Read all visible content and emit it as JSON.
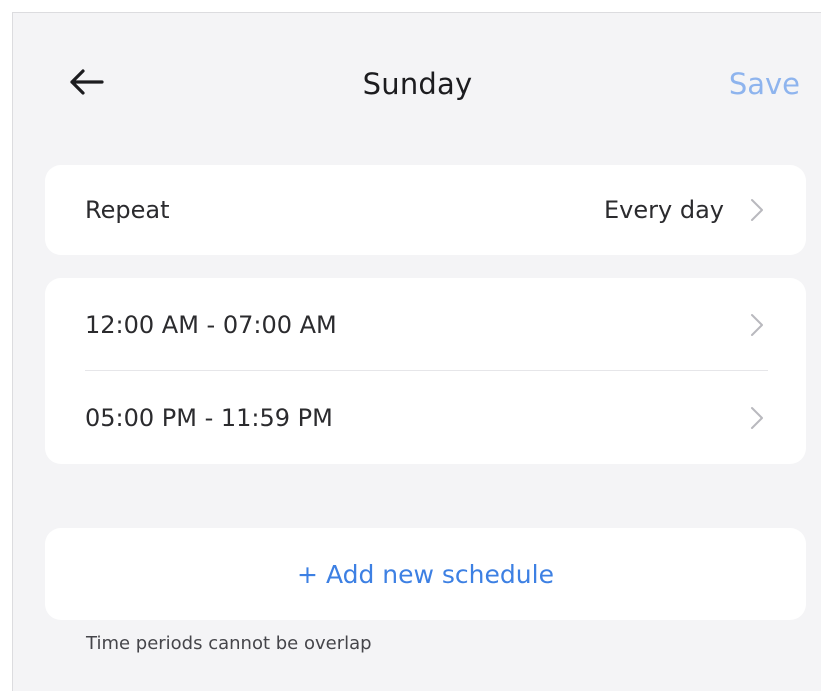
{
  "header": {
    "back_icon": "arrow-left-icon",
    "title": "Sunday",
    "save_label": "Save"
  },
  "repeat": {
    "label": "Repeat",
    "value": "Every day",
    "chevron_icon": "chevron-right-icon"
  },
  "time_periods": [
    {
      "label": "12:00 AM - 07:00 AM",
      "chevron_icon": "chevron-right-icon"
    },
    {
      "label": "05:00 PM - 11:59 PM",
      "chevron_icon": "chevron-right-icon"
    }
  ],
  "add_schedule": {
    "label": "+ Add new schedule"
  },
  "note": "Time periods cannot be overlap",
  "colors": {
    "background": "#f4f4f6",
    "card": "#ffffff",
    "accent": "#3d80e3",
    "save_disabled": "#8eb4ee"
  }
}
